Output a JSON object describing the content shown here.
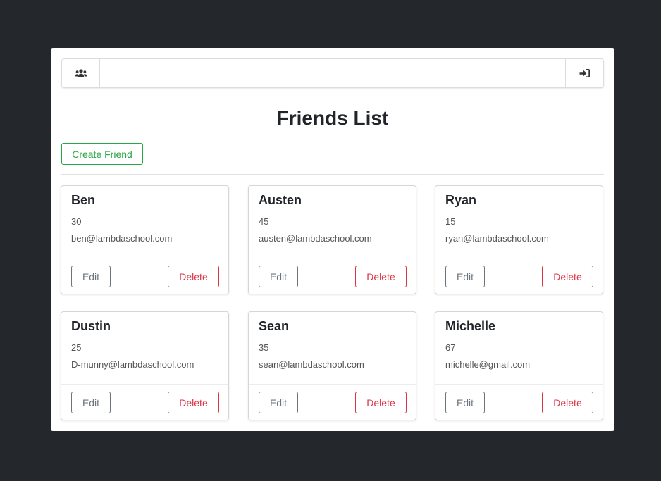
{
  "nav": {
    "left_icon": "users-icon",
    "right_icon": "sign-in-icon"
  },
  "page": {
    "title": "Friends List",
    "create_label": "Create Friend"
  },
  "friends": [
    {
      "name": "Ben",
      "age": "30",
      "email": "ben@lambdaschool.com",
      "edit_label": "Edit",
      "delete_label": "Delete"
    },
    {
      "name": "Austen",
      "age": "45",
      "email": "austen@lambdaschool.com",
      "edit_label": "Edit",
      "delete_label": "Delete"
    },
    {
      "name": "Ryan",
      "age": "15",
      "email": "ryan@lambdaschool.com",
      "edit_label": "Edit",
      "delete_label": "Delete"
    },
    {
      "name": "Dustin",
      "age": "25",
      "email": "D-munny@lambdaschool.com",
      "edit_label": "Edit",
      "delete_label": "Delete"
    },
    {
      "name": "Sean",
      "age": "35",
      "email": "sean@lambdaschool.com",
      "edit_label": "Edit",
      "delete_label": "Delete"
    },
    {
      "name": "Michelle",
      "age": "67",
      "email": "michelle@gmail.com",
      "edit_label": "Edit",
      "delete_label": "Delete"
    }
  ],
  "colors": {
    "background": "#24282c",
    "success": "#28a745",
    "danger": "#dc3545",
    "secondary": "#6c757d"
  }
}
